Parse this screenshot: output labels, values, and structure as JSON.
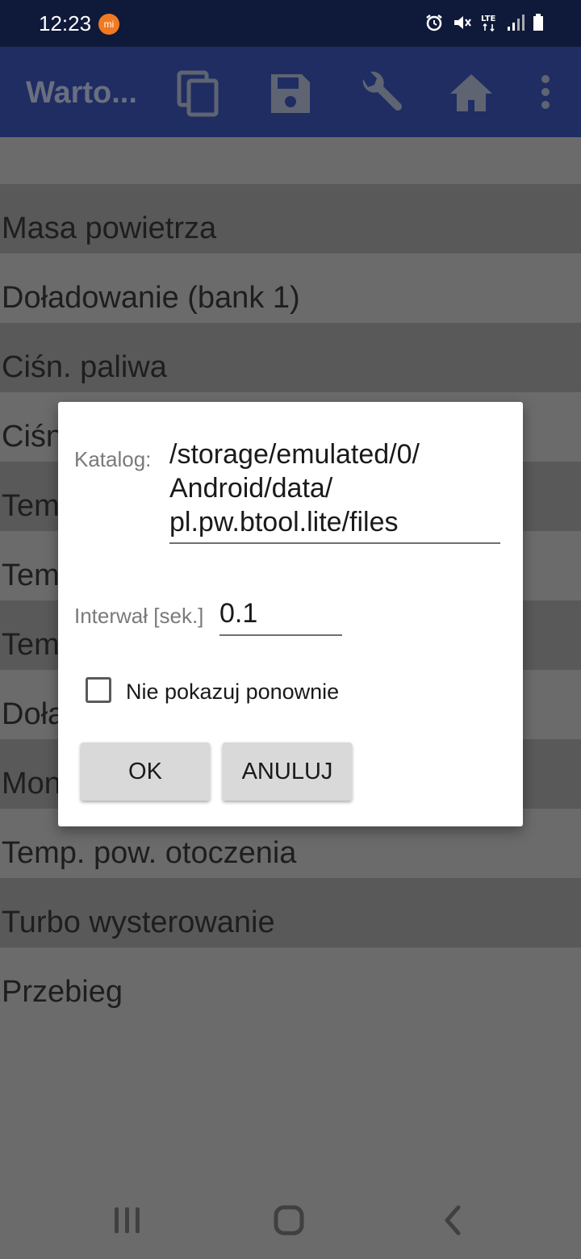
{
  "status_bar": {
    "time": "12:23",
    "icons": [
      "mi-app-icon",
      "alarm-icon",
      "mute-icon",
      "lte-icon",
      "signal-icon",
      "battery-icon"
    ]
  },
  "app_bar": {
    "title": "Warto...",
    "actions": [
      "copy-icon",
      "save-icon",
      "wrench-icon",
      "home-icon",
      "more-vert-icon"
    ],
    "color": "#1f2d63"
  },
  "list": {
    "items": [
      {
        "label": "Masa powietrza"
      },
      {
        "label": "Doładowanie (bank 1)"
      },
      {
        "label": "Ciśn. paliwa"
      },
      {
        "label": "Ciśn"
      },
      {
        "label": "Tem"
      },
      {
        "label": "Tem"
      },
      {
        "label": "Tem"
      },
      {
        "label": "Doła"
      },
      {
        "label": "Mon"
      },
      {
        "label": "Temp. pow. otoczenia"
      },
      {
        "label": "Turbo wysterowanie"
      },
      {
        "label": "Przebieg"
      }
    ]
  },
  "dialog": {
    "catalog_label": "Katalog:",
    "catalog_path": "/storage/emulated/0/ Android/data/ pl.pw.btool.lite/files",
    "interval_label": "Interwał [sek.]",
    "interval_value": "0.1",
    "checkbox_label": "Nie pokazuj ponownie",
    "ok_label": "OK",
    "cancel_label": "ANULUJ"
  },
  "nav_bar": {
    "buttons": [
      "recents-icon",
      "home-nav-icon",
      "back-icon"
    ]
  }
}
